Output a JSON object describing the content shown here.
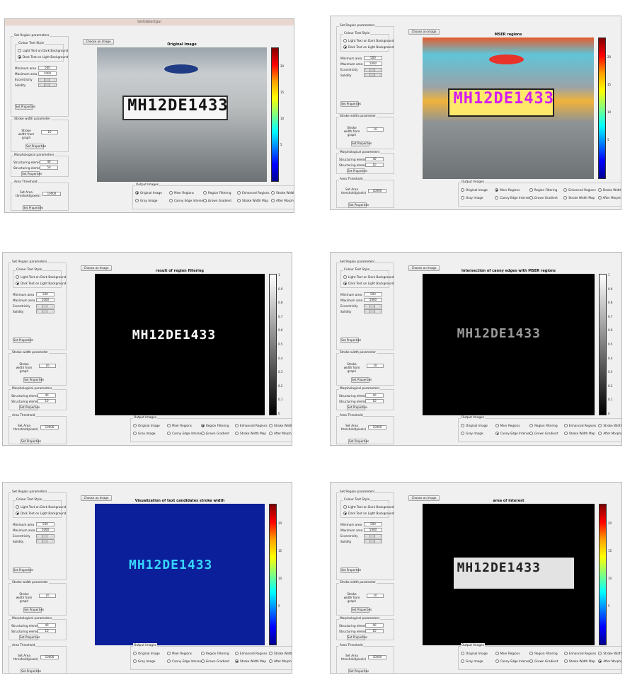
{
  "shared": {
    "set_region": "Set Region parameters",
    "color_text_style": "Colour Text Style",
    "light_text": "Light Text on Dark Background",
    "dark_text": "Dark Text on Light Background",
    "min_area_label": "Minimum area",
    "max_area_label": "Maximum area",
    "eccentricity_label": "Eccentricity",
    "solidity_label": "Solidity",
    "set_properties": "Set Properties",
    "stroke_width_group": "Stroke width parameter",
    "stroke_width_label": "Stroke width from graph",
    "morph_group": "Morphological parameters",
    "struct_elem_label": "Structuring element",
    "area_threshold_group": "Area Threshold",
    "set_area_label": "Set Area threshold(pixels)",
    "choose_image": "Choose an Image",
    "output_images": "Output Images",
    "plate_text": "MH12DE1433",
    "radio_options": [
      "Original Image",
      "Mser Regions",
      "Region Filtering",
      "Enhanced Regions",
      "Stroke Width Filteri...",
      "Gray Image",
      "Canny Edge Intersect...",
      "Grown Gradient",
      "Stroke Width Map",
      "After Morphology ll..."
    ],
    "jet_ticks": [
      "20",
      "15",
      "10",
      "5"
    ],
    "gray_ticks": [
      "1",
      "0.9",
      "0.8",
      "0.7",
      "0.6",
      "0.5",
      "0.4",
      "0.3",
      "0.2",
      "0.1",
      "0"
    ],
    "colors": {
      "panel": "#f0f0f0",
      "jet_top": "#800000",
      "jet_bottom": "#000090",
      "bg_blue": "#0c1f9a"
    }
  },
  "panels": [
    {
      "window_title": "textdetectgui",
      "plot_title": "Original Image",
      "min_area": "500",
      "max_area": "5000",
      "stroke_width": "10",
      "struct1": "40",
      "struct2": "50",
      "area_threshold": "10000",
      "selected": 0
    },
    {
      "window_title": "",
      "plot_title": "MSER regions",
      "min_area": "500",
      "max_area": "5000",
      "stroke_width": "10",
      "struct1": "40",
      "struct2": "10",
      "area_threshold": "10000",
      "selected": 1
    },
    {
      "window_title": "",
      "plot_title": "result of region filtering",
      "min_area": "500",
      "max_area": "5000",
      "stroke_width": "10",
      "struct1": "40",
      "struct2": "10",
      "area_threshold": "10000",
      "selected": 2
    },
    {
      "window_title": "",
      "plot_title": "Intersection of canny edges with MSER regions",
      "min_area": "500",
      "max_area": "5000",
      "stroke_width": "10",
      "struct1": "40",
      "struct2": "10",
      "area_threshold": "10000",
      "selected": 6
    },
    {
      "window_title": "",
      "plot_title": "Visualization of text candidates stroke width",
      "min_area": "500",
      "max_area": "5000",
      "stroke_width": "10",
      "struct1": "40",
      "struct2": "10",
      "area_threshold": "10000",
      "selected": 8
    },
    {
      "window_title": "",
      "plot_title": "area of interest",
      "min_area": "500",
      "max_area": "5000",
      "stroke_width": "10",
      "struct1": "40",
      "struct2": "10",
      "area_threshold": "10000",
      "selected": 9
    }
  ]
}
